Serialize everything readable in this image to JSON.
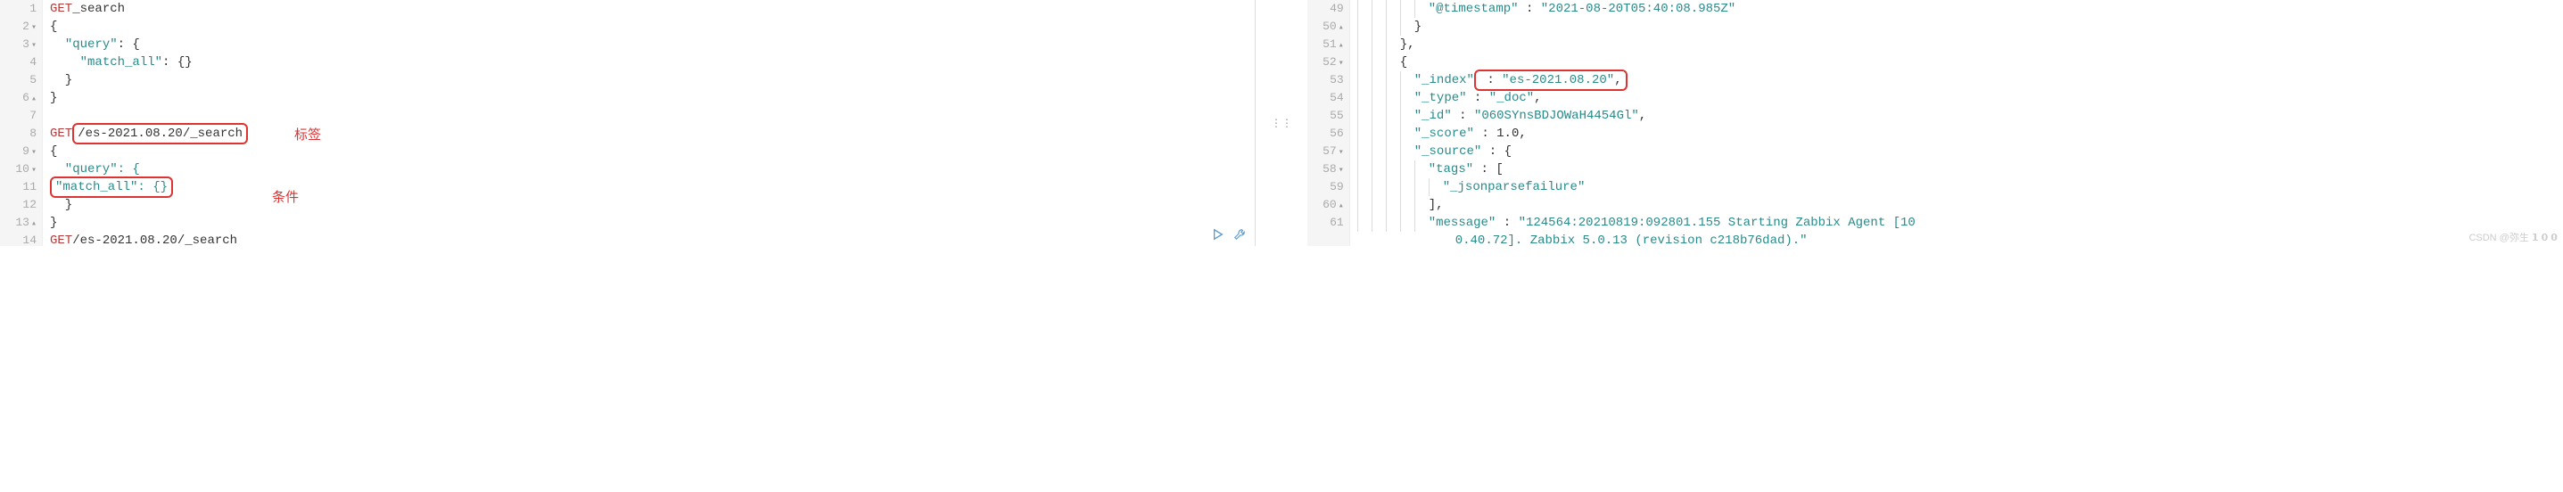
{
  "left": {
    "lines": [
      {
        "n": "1",
        "fold": "",
        "kw": "GET",
        "rest": " _search"
      },
      {
        "n": "2",
        "fold": "▾",
        "txt": "{"
      },
      {
        "n": "3",
        "fold": "▾",
        "txt": "  \"query\": {"
      },
      {
        "n": "4",
        "fold": "",
        "txt": "    \"match_all\": {}"
      },
      {
        "n": "5",
        "fold": "",
        "txt": "  }"
      },
      {
        "n": "6",
        "fold": "▴",
        "txt": "}"
      },
      {
        "n": "7",
        "fold": "",
        "txt": ""
      },
      {
        "n": "8",
        "fold": "",
        "kw": "GET",
        "boxed": "/es-2021.08.20/_search"
      },
      {
        "n": "9",
        "fold": "▾",
        "txt": "{"
      },
      {
        "n": "10",
        "fold": "▾",
        "txt_pre": "  \"query\": {",
        "txt_post": ""
      },
      {
        "n": "11",
        "fold": "",
        "txt_pre": "    ",
        "boxed": "\"match_all\": {}"
      },
      {
        "n": "12",
        "fold": "",
        "txt": "  }"
      },
      {
        "n": "13",
        "fold": "▴",
        "txt": "}"
      },
      {
        "n": "14",
        "fold": "",
        "kw": "GET",
        "rest": " /es-2021.08.20/_search"
      }
    ],
    "annotations": {
      "label1": "标签",
      "label2": "条件"
    }
  },
  "right": {
    "lines": [
      {
        "n": "49",
        "fold": "",
        "indent": 5,
        "key": "\"@timestamp\"",
        "sep": " : ",
        "val": "\"2021-08-20T05:40:08.985Z\""
      },
      {
        "n": "50",
        "fold": "▴",
        "indent": 4,
        "txt": "}"
      },
      {
        "n": "51",
        "fold": "▴",
        "indent": 3,
        "txt": "},"
      },
      {
        "n": "52",
        "fold": "▾",
        "indent": 3,
        "txt": "{"
      },
      {
        "n": "53",
        "fold": "",
        "indent": 4,
        "key": "\"_index\"",
        "boxed_sep_val": " : \"es-2021.08.20\",",
        "highlight": true
      },
      {
        "n": "54",
        "fold": "",
        "indent": 4,
        "key": "\"_type\"",
        "sep": " : ",
        "val": "\"_doc\"",
        "comma": ","
      },
      {
        "n": "55",
        "fold": "",
        "indent": 4,
        "key": "\"_id\"",
        "sep": " : ",
        "val": "\"060SYnsBDJOWaH4454Gl\"",
        "comma": ","
      },
      {
        "n": "56",
        "fold": "",
        "indent": 4,
        "key": "\"_score\"",
        "sep": " : ",
        "num": "1.0",
        "comma": ","
      },
      {
        "n": "57",
        "fold": "▾",
        "indent": 4,
        "key": "\"_source\"",
        "sep": " : ",
        "txt_after": "{"
      },
      {
        "n": "58",
        "fold": "▾",
        "indent": 5,
        "key": "\"tags\"",
        "sep": " : ",
        "txt_after": "["
      },
      {
        "n": "59",
        "fold": "",
        "indent": 6,
        "val": "\"_jsonparsefailure\""
      },
      {
        "n": "60",
        "fold": "▴",
        "indent": 5,
        "txt": "],"
      },
      {
        "n": "61",
        "fold": "",
        "indent": 5,
        "key": "\"message\"",
        "sep": " : ",
        "val": "\"124564:20210819:092801.155 Starting Zabbix Agent [10"
      },
      {
        "n": "",
        "fold": "",
        "indent": 0,
        "cont": "0.40.72]. Zabbix 5.0.13 (revision c218b76dad).\""
      }
    ]
  },
  "watermark": "CSDN @弥生 𝟭 𝟬 𝟬"
}
